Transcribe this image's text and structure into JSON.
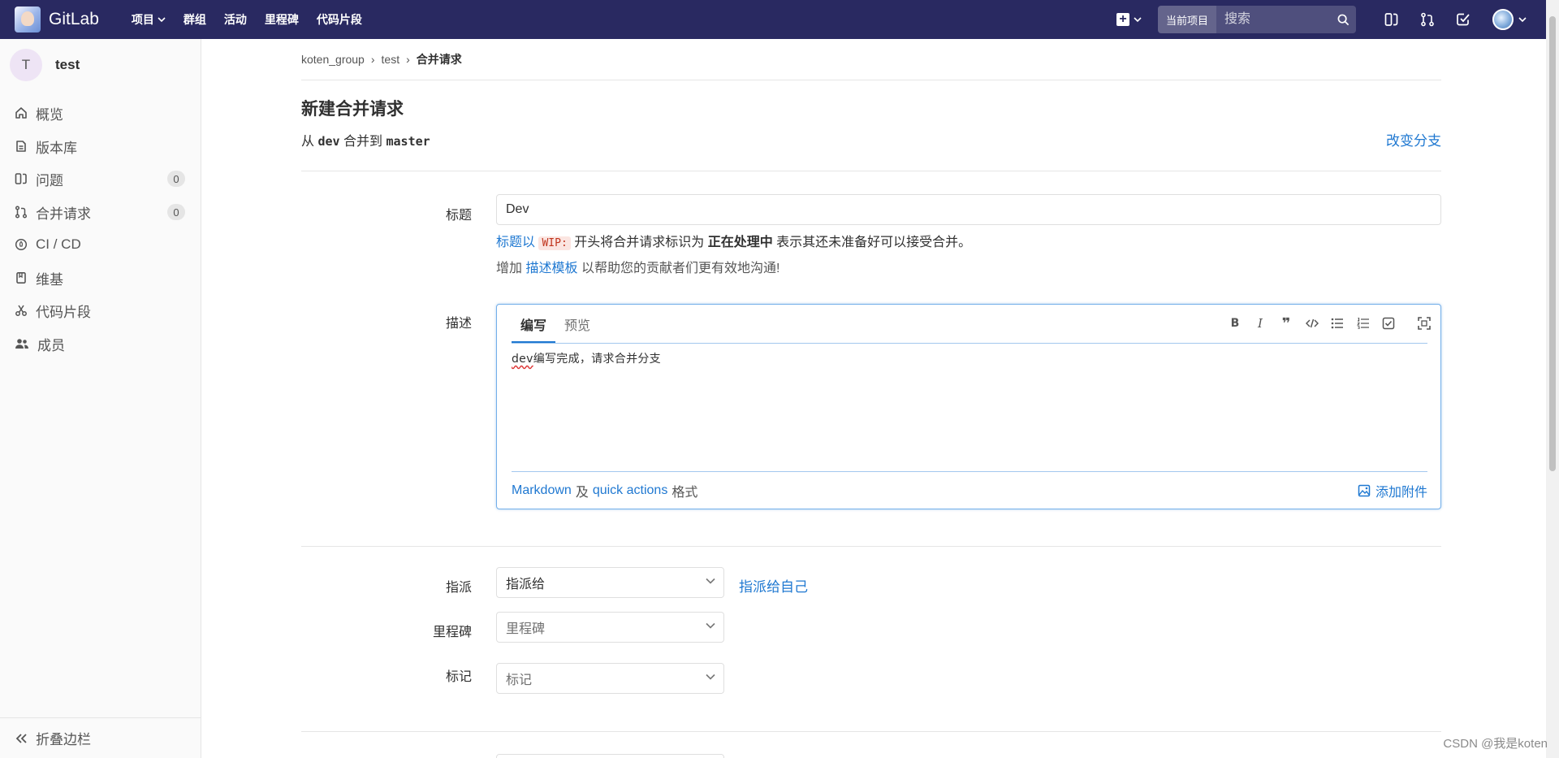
{
  "nav": {
    "logo_text": "GitLab",
    "links": [
      "项目",
      "群组",
      "活动",
      "里程碑",
      "代码片段"
    ],
    "search_scope": "当前项目",
    "search_placeholder": "搜索"
  },
  "sidebar": {
    "project_initial": "T",
    "project_name": "test",
    "items": [
      {
        "label": "概览",
        "icon": "home-icon"
      },
      {
        "label": "版本库",
        "icon": "repository-icon"
      },
      {
        "label": "问题",
        "icon": "issues-icon",
        "count": "0"
      },
      {
        "label": "合并请求",
        "icon": "merge-request-icon",
        "count": "0"
      },
      {
        "label": "CI / CD",
        "icon": "rocket-icon"
      },
      {
        "label": "维基",
        "icon": "book-icon"
      },
      {
        "label": "代码片段",
        "icon": "scissors-icon"
      },
      {
        "label": "成员",
        "icon": "users-icon"
      }
    ],
    "collapse_label": "折叠边栏"
  },
  "breadcrumb": [
    "koten_group",
    "test",
    "合并请求"
  ],
  "page": {
    "title": "新建合并请求",
    "from_prefix": "从",
    "source_branch": "dev",
    "merge_to": "合并到",
    "target_branch": "master",
    "change_branch": "改变分支"
  },
  "form": {
    "title_label": "标题",
    "title_value": "Dev",
    "wip_hint_link": "标题以",
    "wip_code": "WIP:",
    "wip_hint_mid": "开头将合并请求标识为",
    "wip_hint_bold": "正在处理中",
    "wip_hint_end": "表示其还未准备好可以接受合并。",
    "template_prefix": "增加",
    "template_link": "描述模板",
    "template_suffix": "以帮助您的贡献者们更有效地沟通!",
    "description_label": "描述",
    "tab_write": "编写",
    "tab_preview": "预览",
    "description_spellword": "dev",
    "description_rest": "编写完成，请求合并分支",
    "footer_markdown": "Markdown",
    "footer_and": "及",
    "footer_quick": "quick actions",
    "footer_format": "格式",
    "attach_label": "添加附件",
    "assignee_label": "指派",
    "assignee_value": "指派给",
    "assign_to_me": "指派给自己",
    "milestone_label": "里程碑",
    "milestone_value": "里程碑",
    "labels_label": "标记",
    "labels_value": "标记"
  },
  "watermark": "CSDN @我是koten"
}
